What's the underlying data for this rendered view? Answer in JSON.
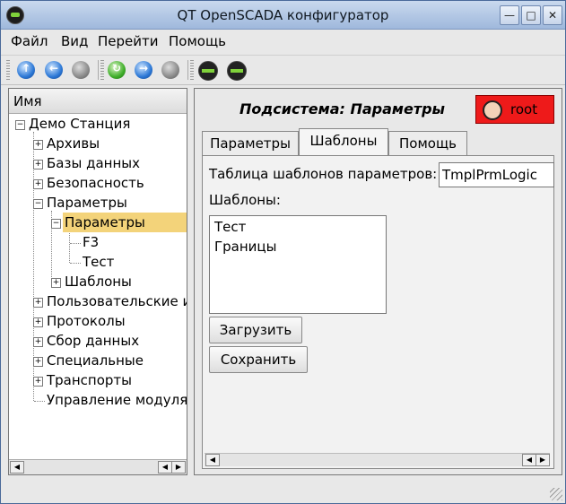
{
  "window": {
    "title": "QT OpenSCADA конфигуратор"
  },
  "titlebar_buttons": {
    "minimize": "—",
    "maximize": "□",
    "close": "✕"
  },
  "menu": [
    {
      "label": "Файл"
    },
    {
      "label": "Вид"
    },
    {
      "label": "Перейти"
    },
    {
      "label": "Помощь"
    }
  ],
  "toolbar_icons": [
    "up-icon",
    "back-icon",
    "stop-icon",
    "reload-icon",
    "forward-icon",
    "stop-icon",
    "network-icon",
    "network-icon"
  ],
  "tree": {
    "header": "Имя",
    "items": [
      {
        "label": "Демо Станция"
      },
      {
        "label": "Архивы"
      },
      {
        "label": "Базы данных"
      },
      {
        "label": "Безопасность"
      },
      {
        "label": "Параметры"
      },
      {
        "label": "Параметры"
      },
      {
        "label": "F3"
      },
      {
        "label": "Тест"
      },
      {
        "label": "Шаблоны"
      },
      {
        "label": "Пользовательские ин"
      },
      {
        "label": "Протоколы"
      },
      {
        "label": "Сбор данных"
      },
      {
        "label": "Специальные"
      },
      {
        "label": "Транспорты"
      },
      {
        "label": "Управление модулям"
      }
    ]
  },
  "panel": {
    "title": "Подсистема: Параметры",
    "user": "root",
    "tabs": [
      {
        "label": "Параметры"
      },
      {
        "label": "Шаблоны"
      },
      {
        "label": "Помощь"
      }
    ],
    "table_label": "Таблица шаблонов параметров:",
    "table_value": "TmplPrmLogic",
    "templates_label": "Шаблоны:",
    "templates": [
      "Тест",
      "Границы"
    ],
    "load_button": "Загрузить",
    "save_button": "Сохранить"
  },
  "colors": {
    "selection": "#f3d37a",
    "user_button": "#ee1a1a",
    "titlebar": "#9fb8dc"
  }
}
